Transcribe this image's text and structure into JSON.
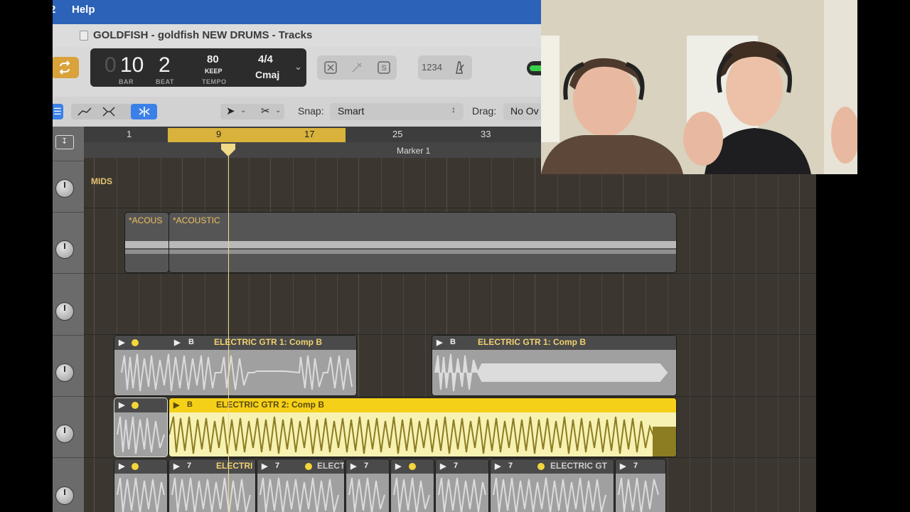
{
  "menubar": {
    "partial_left": "2",
    "help": "Help"
  },
  "window": {
    "title": "GOLDFISH - goldfish NEW DRUMS - Tracks"
  },
  "lcd": {
    "bar_dim": "0",
    "bar": "10",
    "beat": "2",
    "bar_label": "BAR",
    "beat_label": "BEAT",
    "tempo": "80",
    "tempo_mode": "KEEP",
    "tempo_label": "TEMPO",
    "time_sig": "4/4",
    "key": "Cmaj"
  },
  "controls": {
    "count_in": "1234"
  },
  "toolbar": {
    "snap_label": "Snap:",
    "snap_value": "Smart",
    "drag_label": "Drag:",
    "drag_value": "No Ov"
  },
  "ruler": {
    "bars": [
      "1",
      "9",
      "17",
      "25",
      "33"
    ],
    "marker": "Marker 1"
  },
  "tracks": {
    "mids_label": "MIDS",
    "acoustic_a": "*ACOUS",
    "acoustic_b": "*ACOUSTIC",
    "egtr1_a": "ELECTRIC GTR 1: Comp B",
    "egtr1_b": "ELECTRIC GTR 1: Comp B",
    "egtr2": "ELECTRIC GTR 2: Comp B",
    "bottom_a": "ELECTRI",
    "bottom_b": "ELECT",
    "bottom_c": "ELECTRIC GT",
    "take_b": "B",
    "take_7": "7"
  },
  "colors": {
    "accent_yellow": "#f5d019",
    "menubar_blue": "#2c63b8",
    "region_gray": "#9f9f9f",
    "cycle_yellow": "#d9b23b"
  },
  "video": {
    "description_icon": "webcam-feed"
  }
}
